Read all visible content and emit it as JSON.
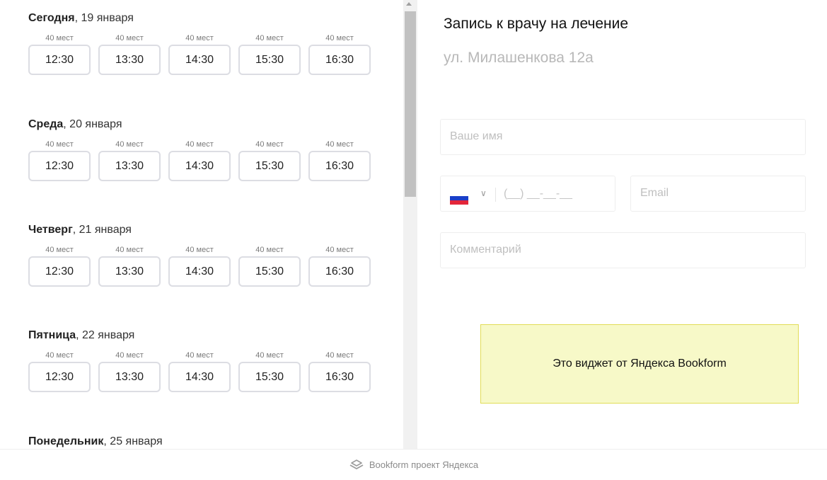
{
  "schedule": {
    "days": [
      {
        "day": "Сегодня",
        "date": ", 19 января",
        "slots": [
          {
            "cap": "40 мест",
            "time": "12:30"
          },
          {
            "cap": "40 мест",
            "time": "13:30"
          },
          {
            "cap": "40 мест",
            "time": "14:30"
          },
          {
            "cap": "40 мест",
            "time": "15:30"
          },
          {
            "cap": "40 мест",
            "time": "16:30"
          }
        ]
      },
      {
        "day": "Среда",
        "date": ", 20 января",
        "slots": [
          {
            "cap": "40 мест",
            "time": "12:30"
          },
          {
            "cap": "40 мест",
            "time": "13:30"
          },
          {
            "cap": "40 мест",
            "time": "14:30"
          },
          {
            "cap": "40 мест",
            "time": "15:30"
          },
          {
            "cap": "40 мест",
            "time": "16:30"
          }
        ]
      },
      {
        "day": "Четверг",
        "date": ", 21 января",
        "slots": [
          {
            "cap": "40 мест",
            "time": "12:30"
          },
          {
            "cap": "40 мест",
            "time": "13:30"
          },
          {
            "cap": "40 мест",
            "time": "14:30"
          },
          {
            "cap": "40 мест",
            "time": "15:30"
          },
          {
            "cap": "40 мест",
            "time": "16:30"
          }
        ]
      },
      {
        "day": "Пятница",
        "date": ", 22 января",
        "slots": [
          {
            "cap": "40 мест",
            "time": "12:30"
          },
          {
            "cap": "40 мест",
            "time": "13:30"
          },
          {
            "cap": "40 мест",
            "time": "14:30"
          },
          {
            "cap": "40 мест",
            "time": "15:30"
          },
          {
            "cap": "40 мест",
            "time": "16:30"
          }
        ]
      },
      {
        "day": "Понедельник",
        "date": ", 25 января",
        "slots": []
      }
    ]
  },
  "form": {
    "title": "Запись к врачу на лечение",
    "address": "ул. Милашенкова 12а",
    "name_placeholder": "Ваше имя",
    "phone_mask": "(__) __-__-__",
    "email_placeholder": "Email",
    "comment_placeholder": "Комментарий",
    "country_flag": "russia-flag-icon"
  },
  "widget_note": "Это виджет от Яндекса Bookform",
  "footer": {
    "brand": "Bookform проект Яндекса",
    "icon": "bookform-logo-icon"
  },
  "colors": {
    "slot_border": "#dcdde3",
    "note_bg": "#f7f9c8",
    "note_border": "#e1dd57"
  }
}
